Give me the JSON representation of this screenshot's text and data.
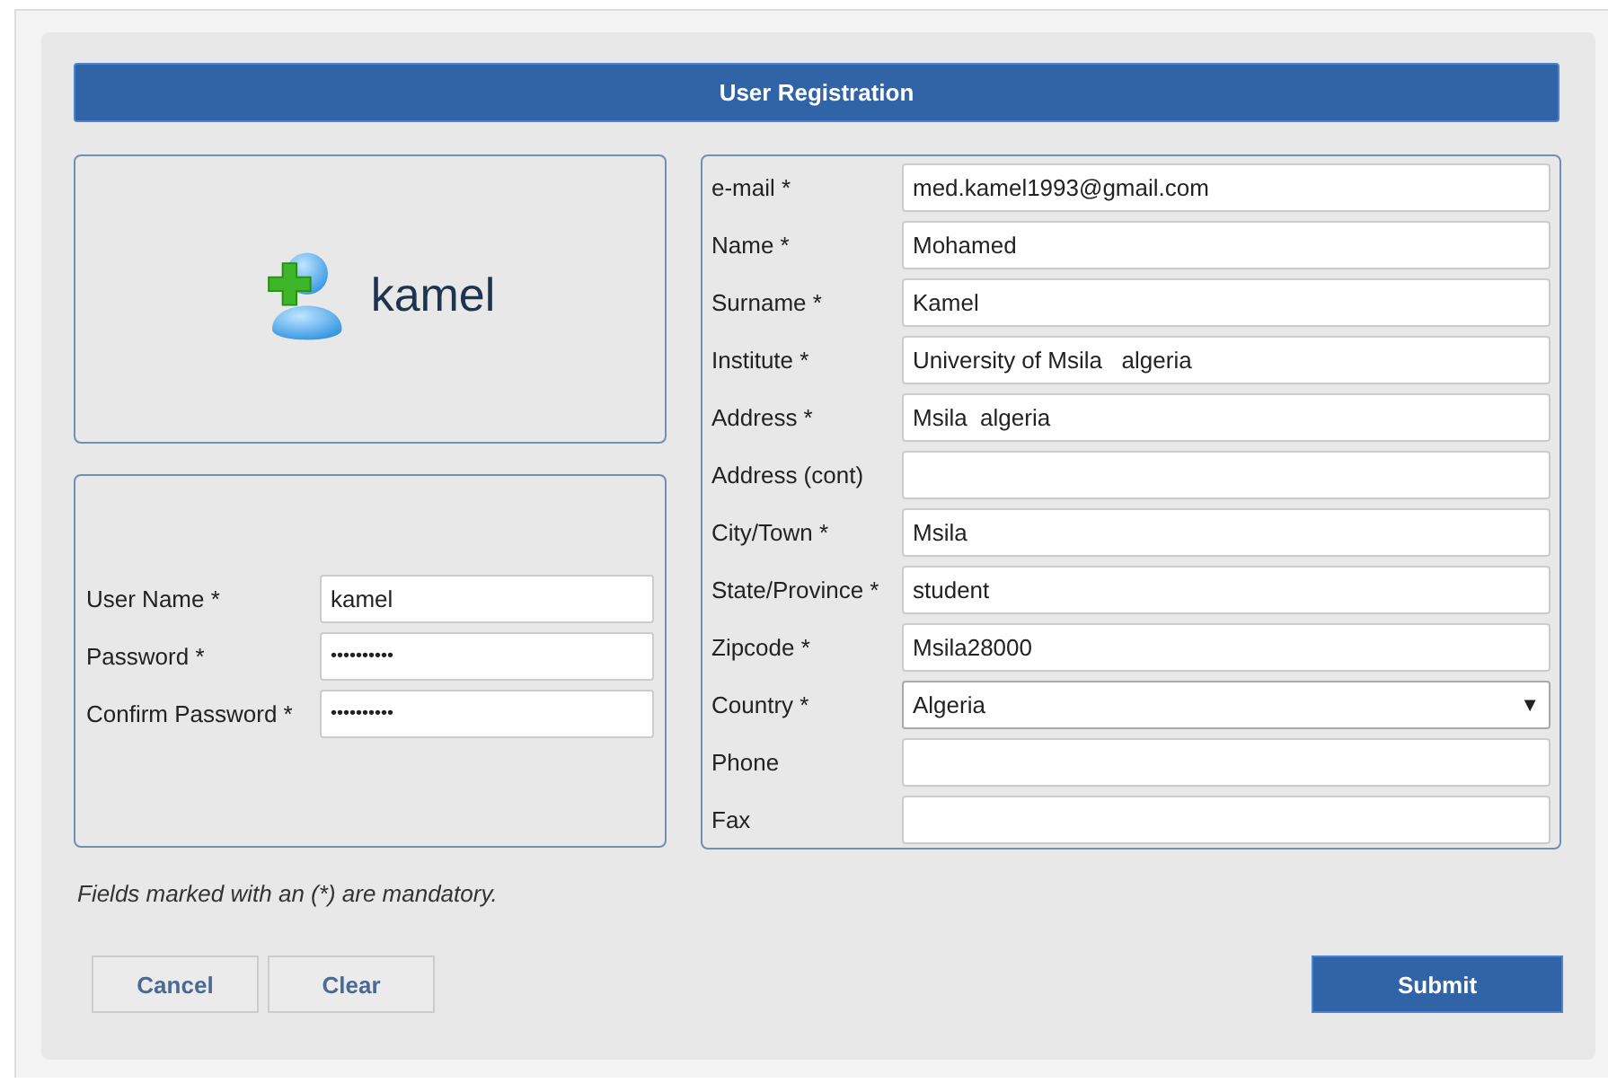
{
  "title": "User Registration",
  "profile": {
    "name": "kamel"
  },
  "account_fields": [
    {
      "label": "User Name *",
      "kind": "text",
      "value": "kamel"
    },
    {
      "label": "Password *",
      "kind": "password",
      "value": "••••••••••"
    },
    {
      "label": "Confirm Password *",
      "kind": "password",
      "value": "••••••••••"
    }
  ],
  "details_fields": [
    {
      "label": "e-mail *",
      "kind": "text",
      "value": "med.kamel1993@gmail.com"
    },
    {
      "label": "Name *",
      "kind": "text",
      "value": "Mohamed"
    },
    {
      "label": "Surname *",
      "kind": "text",
      "value": "Kamel"
    },
    {
      "label": "Institute *",
      "kind": "text",
      "value": "University of Msila   algeria"
    },
    {
      "label": "Address *",
      "kind": "text",
      "value": "Msila  algeria"
    },
    {
      "label": "Address (cont)",
      "kind": "text"
    },
    {
      "label": "City/Town *",
      "kind": "text",
      "value": "Msila"
    },
    {
      "label": "State/Province *",
      "kind": "text",
      "value": "student"
    },
    {
      "label": "Zipcode *",
      "kind": "text",
      "value": "Msila28000"
    },
    {
      "label": "Country *",
      "kind": "select",
      "value": "Algeria",
      "caret": "▼"
    },
    {
      "label": "Phone",
      "kind": "text"
    },
    {
      "label": "Fax",
      "kind": "text"
    }
  ],
  "note": "Fields marked with an (*) are mandatory.",
  "buttons": [
    {
      "label": "Cancel",
      "kind": "secondary"
    },
    {
      "label": "Clear",
      "kind": "secondary"
    },
    {
      "label": "Submit",
      "kind": "primary"
    }
  ]
}
